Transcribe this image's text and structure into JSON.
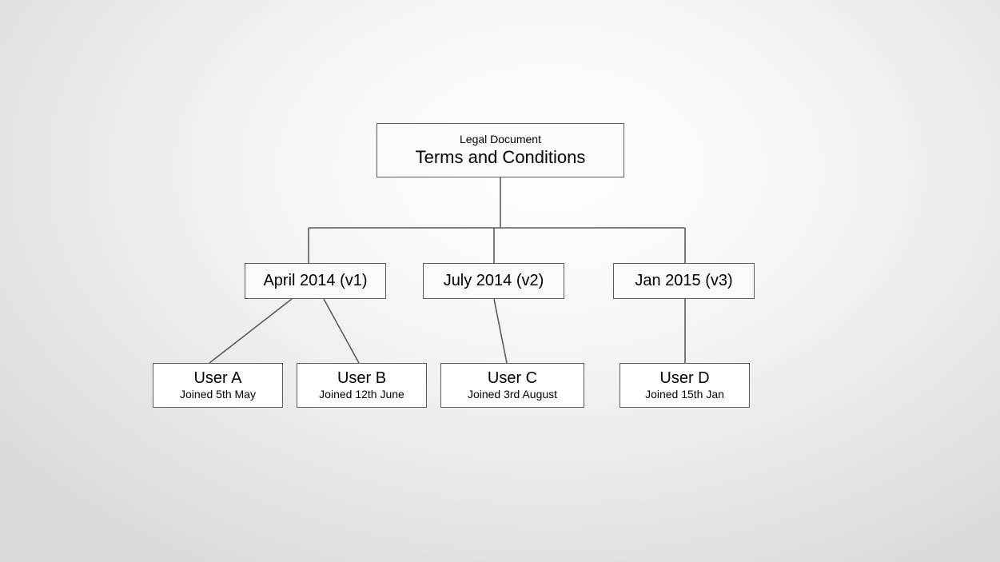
{
  "root": {
    "category": "Legal Document",
    "title": "Terms and Conditions"
  },
  "versions": [
    {
      "label": "April 2014 (v1)"
    },
    {
      "label": "July 2014 (v2)"
    },
    {
      "label": "Jan 2015 (v3)"
    }
  ],
  "users": [
    {
      "name": "User A",
      "joined": "Joined 5th May"
    },
    {
      "name": "User B",
      "joined": "Joined 12th June"
    },
    {
      "name": "User C",
      "joined": "Joined 3rd August"
    },
    {
      "name": "User D",
      "joined": "Joined 15th Jan"
    }
  ]
}
